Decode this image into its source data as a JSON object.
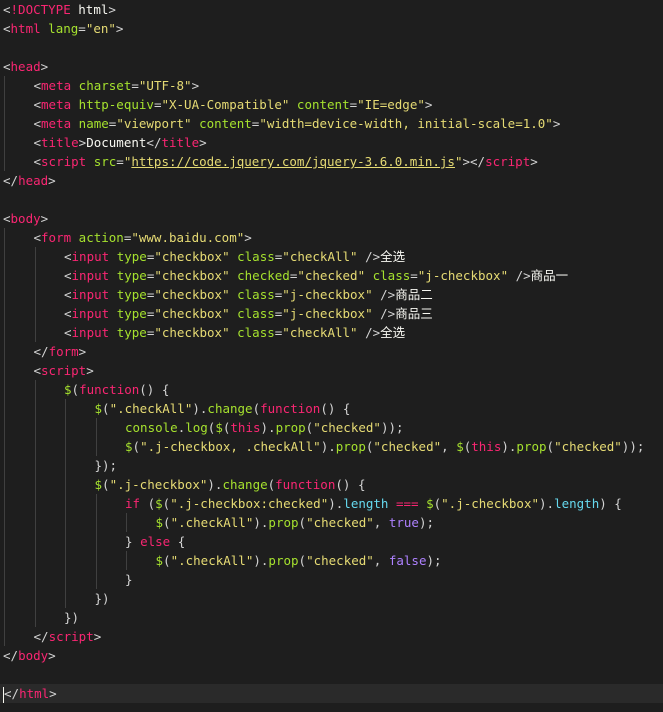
{
  "editor": {
    "lines": [
      {
        "indent": 0,
        "tokens": [
          [
            "punct",
            "<"
          ],
          [
            "doctype",
            "!DOCTYPE"
          ],
          [
            "text",
            " html"
          ],
          [
            "punct",
            ">"
          ]
        ]
      },
      {
        "indent": 0,
        "tokens": [
          [
            "punct",
            "<"
          ],
          [
            "tag",
            "html"
          ],
          [
            "attr",
            " lang"
          ],
          [
            "punct",
            "="
          ],
          [
            "str",
            "\"en\""
          ],
          [
            "punct",
            ">"
          ]
        ]
      },
      {
        "indent": 0,
        "tokens": []
      },
      {
        "indent": 0,
        "tokens": [
          [
            "punct",
            "<"
          ],
          [
            "tag",
            "head"
          ],
          [
            "punct",
            ">"
          ]
        ]
      },
      {
        "indent": 1,
        "tokens": [
          [
            "punct",
            "<"
          ],
          [
            "tag",
            "meta"
          ],
          [
            "attr",
            " charset"
          ],
          [
            "punct",
            "="
          ],
          [
            "str",
            "\"UTF-8\""
          ],
          [
            "punct",
            ">"
          ]
        ]
      },
      {
        "indent": 1,
        "tokens": [
          [
            "punct",
            "<"
          ],
          [
            "tag",
            "meta"
          ],
          [
            "attr",
            " http-equiv"
          ],
          [
            "punct",
            "="
          ],
          [
            "str",
            "\"X-UA-Compatible\""
          ],
          [
            "attr",
            " content"
          ],
          [
            "punct",
            "="
          ],
          [
            "str",
            "\"IE=edge\""
          ],
          [
            "punct",
            ">"
          ]
        ]
      },
      {
        "indent": 1,
        "tokens": [
          [
            "punct",
            "<"
          ],
          [
            "tag",
            "meta"
          ],
          [
            "attr",
            " name"
          ],
          [
            "punct",
            "="
          ],
          [
            "str",
            "\"viewport\""
          ],
          [
            "attr",
            " content"
          ],
          [
            "punct",
            "="
          ],
          [
            "str",
            "\"width=device-width, initial-scale=1.0\""
          ],
          [
            "punct",
            ">"
          ]
        ]
      },
      {
        "indent": 1,
        "tokens": [
          [
            "punct",
            "<"
          ],
          [
            "tag",
            "title"
          ],
          [
            "punct",
            ">"
          ],
          [
            "text",
            "Document"
          ],
          [
            "punct",
            "</"
          ],
          [
            "tag",
            "title"
          ],
          [
            "punct",
            ">"
          ]
        ]
      },
      {
        "indent": 1,
        "tokens": [
          [
            "punct",
            "<"
          ],
          [
            "tag",
            "script"
          ],
          [
            "attr",
            " src"
          ],
          [
            "punct",
            "="
          ],
          [
            "str",
            "\""
          ],
          [
            "link",
            "https://code.jquery.com/jquery-3.6.0.min.js"
          ],
          [
            "str",
            "\""
          ],
          [
            "punct",
            "></"
          ],
          [
            "tag",
            "script"
          ],
          [
            "punct",
            ">"
          ]
        ]
      },
      {
        "indent": 0,
        "tokens": [
          [
            "punct",
            "</"
          ],
          [
            "tag",
            "head"
          ],
          [
            "punct",
            ">"
          ]
        ]
      },
      {
        "indent": 0,
        "tokens": []
      },
      {
        "indent": 0,
        "tokens": [
          [
            "punct",
            "<"
          ],
          [
            "tag",
            "body"
          ],
          [
            "punct",
            ">"
          ]
        ]
      },
      {
        "indent": 1,
        "tokens": [
          [
            "punct",
            "<"
          ],
          [
            "tag",
            "form"
          ],
          [
            "attr",
            " action"
          ],
          [
            "punct",
            "="
          ],
          [
            "str",
            "\"www.baidu.com\""
          ],
          [
            "punct",
            ">"
          ]
        ]
      },
      {
        "indent": 2,
        "tokens": [
          [
            "punct",
            "<"
          ],
          [
            "tag",
            "input"
          ],
          [
            "attr",
            " type"
          ],
          [
            "punct",
            "="
          ],
          [
            "str",
            "\"checkbox\""
          ],
          [
            "attr",
            " class"
          ],
          [
            "punct",
            "="
          ],
          [
            "str",
            "\"checkAll\""
          ],
          [
            "punct",
            " />"
          ],
          [
            "text",
            "全选"
          ]
        ]
      },
      {
        "indent": 2,
        "tokens": [
          [
            "punct",
            "<"
          ],
          [
            "tag",
            "input"
          ],
          [
            "attr",
            " type"
          ],
          [
            "punct",
            "="
          ],
          [
            "str",
            "\"checkbox\""
          ],
          [
            "attr",
            " checked"
          ],
          [
            "punct",
            "="
          ],
          [
            "str",
            "\"checked\""
          ],
          [
            "attr",
            " class"
          ],
          [
            "punct",
            "="
          ],
          [
            "str",
            "\"j-checkbox\""
          ],
          [
            "punct",
            " />"
          ],
          [
            "text",
            "商品一"
          ]
        ]
      },
      {
        "indent": 2,
        "tokens": [
          [
            "punct",
            "<"
          ],
          [
            "tag",
            "input"
          ],
          [
            "attr",
            " type"
          ],
          [
            "punct",
            "="
          ],
          [
            "str",
            "\"checkbox\""
          ],
          [
            "attr",
            " class"
          ],
          [
            "punct",
            "="
          ],
          [
            "str",
            "\"j-checkbox\""
          ],
          [
            "punct",
            " />"
          ],
          [
            "text",
            "商品二"
          ]
        ]
      },
      {
        "indent": 2,
        "tokens": [
          [
            "punct",
            "<"
          ],
          [
            "tag",
            "input"
          ],
          [
            "attr",
            " type"
          ],
          [
            "punct",
            "="
          ],
          [
            "str",
            "\"checkbox\""
          ],
          [
            "attr",
            " class"
          ],
          [
            "punct",
            "="
          ],
          [
            "str",
            "\"j-checkbox\""
          ],
          [
            "punct",
            " />"
          ],
          [
            "text",
            "商品三"
          ]
        ]
      },
      {
        "indent": 2,
        "tokens": [
          [
            "punct",
            "<"
          ],
          [
            "tag",
            "input"
          ],
          [
            "attr",
            " type"
          ],
          [
            "punct",
            "="
          ],
          [
            "str",
            "\"checkbox\""
          ],
          [
            "attr",
            " class"
          ],
          [
            "punct",
            "="
          ],
          [
            "str",
            "\"checkAll\""
          ],
          [
            "punct",
            " />"
          ],
          [
            "text",
            "全选"
          ]
        ]
      },
      {
        "indent": 1,
        "tokens": [
          [
            "punct",
            "</"
          ],
          [
            "tag",
            "form"
          ],
          [
            "punct",
            ">"
          ]
        ]
      },
      {
        "indent": 1,
        "tokens": [
          [
            "punct",
            "<"
          ],
          [
            "tag",
            "script"
          ],
          [
            "punct",
            ">"
          ]
        ]
      },
      {
        "indent": 2,
        "tokens": [
          [
            "fn",
            "$"
          ],
          [
            "punct",
            "("
          ],
          [
            "kw",
            "function"
          ],
          [
            "punct",
            "() {"
          ]
        ]
      },
      {
        "indent": 3,
        "tokens": [
          [
            "fn",
            "$"
          ],
          [
            "punct",
            "("
          ],
          [
            "str",
            "\".checkAll\""
          ],
          [
            "punct",
            ")."
          ],
          [
            "fn",
            "change"
          ],
          [
            "punct",
            "("
          ],
          [
            "kw",
            "function"
          ],
          [
            "punct",
            "() {"
          ]
        ]
      },
      {
        "indent": 4,
        "tokens": [
          [
            "fn",
            "console"
          ],
          [
            "punct",
            "."
          ],
          [
            "fn",
            "log"
          ],
          [
            "punct",
            "("
          ],
          [
            "fn",
            "$"
          ],
          [
            "punct",
            "("
          ],
          [
            "this",
            "this"
          ],
          [
            "punct",
            ")."
          ],
          [
            "fn",
            "prop"
          ],
          [
            "punct",
            "("
          ],
          [
            "str",
            "\"checked\""
          ],
          [
            "punct",
            "));"
          ]
        ]
      },
      {
        "indent": 4,
        "tokens": [
          [
            "fn",
            "$"
          ],
          [
            "punct",
            "("
          ],
          [
            "str",
            "\".j-checkbox, .checkAll\""
          ],
          [
            "punct",
            ")."
          ],
          [
            "fn",
            "prop"
          ],
          [
            "punct",
            "("
          ],
          [
            "str",
            "\"checked\""
          ],
          [
            "punct",
            ", "
          ],
          [
            "fn",
            "$"
          ],
          [
            "punct",
            "("
          ],
          [
            "this",
            "this"
          ],
          [
            "punct",
            ")."
          ],
          [
            "fn",
            "prop"
          ],
          [
            "punct",
            "("
          ],
          [
            "str",
            "\"checked\""
          ],
          [
            "punct",
            "));"
          ]
        ]
      },
      {
        "indent": 3,
        "tokens": [
          [
            "punct",
            "});"
          ]
        ]
      },
      {
        "indent": 3,
        "tokens": [
          [
            "fn",
            "$"
          ],
          [
            "punct",
            "("
          ],
          [
            "str",
            "\".j-checkbox\""
          ],
          [
            "punct",
            ")."
          ],
          [
            "fn",
            "change"
          ],
          [
            "punct",
            "("
          ],
          [
            "kw",
            "function"
          ],
          [
            "punct",
            "() {"
          ]
        ]
      },
      {
        "indent": 4,
        "tokens": [
          [
            "kw",
            "if"
          ],
          [
            "punct",
            " ("
          ],
          [
            "fn",
            "$"
          ],
          [
            "punct",
            "("
          ],
          [
            "str",
            "\".j-checkbox:checked\""
          ],
          [
            "punct",
            ")."
          ],
          [
            "prop",
            "length"
          ],
          [
            "punct",
            " "
          ],
          [
            "op",
            "==="
          ],
          [
            "punct",
            " "
          ],
          [
            "fn",
            "$"
          ],
          [
            "punct",
            "("
          ],
          [
            "str",
            "\".j-checkbox\""
          ],
          [
            "punct",
            ")."
          ],
          [
            "prop",
            "length"
          ],
          [
            "punct",
            ") {"
          ]
        ]
      },
      {
        "indent": 5,
        "tokens": [
          [
            "fn",
            "$"
          ],
          [
            "punct",
            "("
          ],
          [
            "str",
            "\".checkAll\""
          ],
          [
            "punct",
            ")."
          ],
          [
            "fn",
            "prop"
          ],
          [
            "punct",
            "("
          ],
          [
            "str",
            "\"checked\""
          ],
          [
            "punct",
            ", "
          ],
          [
            "bool",
            "true"
          ],
          [
            "punct",
            ");"
          ]
        ]
      },
      {
        "indent": 4,
        "tokens": [
          [
            "punct",
            "} "
          ],
          [
            "kw",
            "else"
          ],
          [
            "punct",
            " {"
          ]
        ]
      },
      {
        "indent": 5,
        "tokens": [
          [
            "fn",
            "$"
          ],
          [
            "punct",
            "("
          ],
          [
            "str",
            "\".checkAll\""
          ],
          [
            "punct",
            ")."
          ],
          [
            "fn",
            "prop"
          ],
          [
            "punct",
            "("
          ],
          [
            "str",
            "\"checked\""
          ],
          [
            "punct",
            ", "
          ],
          [
            "bool",
            "false"
          ],
          [
            "punct",
            ");"
          ]
        ]
      },
      {
        "indent": 4,
        "tokens": [
          [
            "punct",
            "}"
          ]
        ]
      },
      {
        "indent": 3,
        "tokens": [
          [
            "punct",
            "})"
          ]
        ]
      },
      {
        "indent": 2,
        "tokens": [
          [
            "punct",
            "})"
          ]
        ]
      },
      {
        "indent": 1,
        "tokens": [
          [
            "punct",
            "</"
          ],
          [
            "tag",
            "script"
          ],
          [
            "punct",
            ">"
          ]
        ]
      },
      {
        "indent": 0,
        "tokens": [
          [
            "punct",
            "</"
          ],
          [
            "tag",
            "body"
          ],
          [
            "punct",
            ">"
          ]
        ]
      },
      {
        "indent": 0,
        "tokens": []
      },
      {
        "indent": 0,
        "active": true,
        "tokens": [
          [
            "cursor",
            ""
          ],
          [
            "punct",
            "</"
          ],
          [
            "tag",
            "html"
          ],
          [
            "punct",
            ">"
          ]
        ]
      }
    ]
  }
}
